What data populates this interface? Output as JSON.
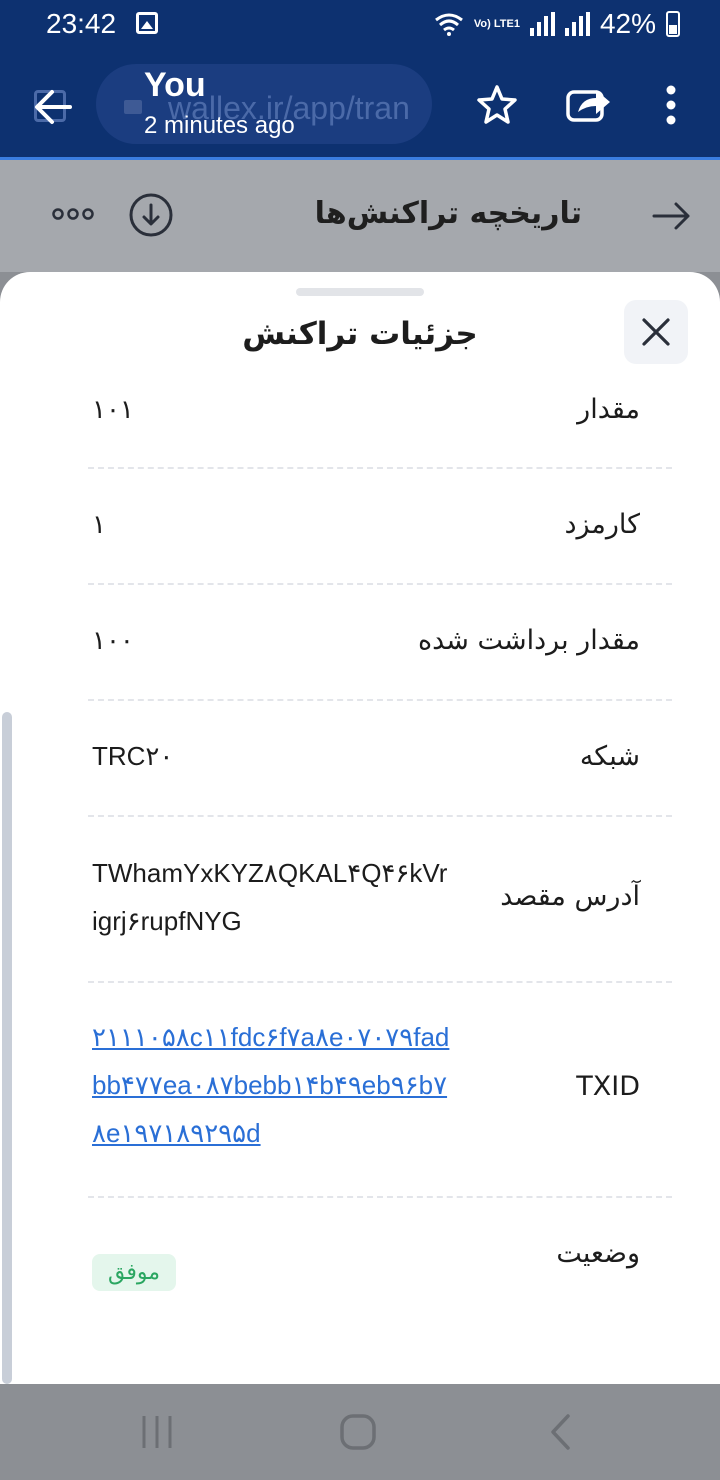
{
  "status_bar": {
    "time": "23:42",
    "network": "Vo) LTE1",
    "battery": "42%"
  },
  "browser": {
    "url": "wallex.ir/app/tran",
    "notification_title": "You",
    "notification_subtitle": "2 minutes ago"
  },
  "page": {
    "title": "تاریخچه تراکنش‌ها"
  },
  "sheet": {
    "title": "جزئیات تراکنش",
    "rows": [
      {
        "label": "مقدار",
        "value": "۱۰۱"
      },
      {
        "label": "کارمزد",
        "value": "۱"
      },
      {
        "label": "مقدار برداشت شده",
        "value": "۱۰۰"
      },
      {
        "label": "شبکه",
        "value": "TRC۲۰"
      },
      {
        "label": "آدرس مقصد",
        "value": "TWhamYxKYZ۸QKAL۴Q۴۶kVrigrj۶rupfNYG"
      },
      {
        "label": "TXID",
        "value": "۲۱۱۱۰۵۸c۱۱fdc۶f۷a۸e۰۷۰۷۹fadbb۴۷۷ea۰۸۷bebb۱۴b۴۹eb۹۶b۷۸e۱۹۷۱۸۹۲۹۵d"
      },
      {
        "label": "وضعیت",
        "value": "موفق"
      }
    ]
  },
  "colors": {
    "browser_bar": "#0d3170",
    "link": "#2a6fd6",
    "success_bg": "#e4f6ec",
    "success_text": "#2aa661"
  }
}
